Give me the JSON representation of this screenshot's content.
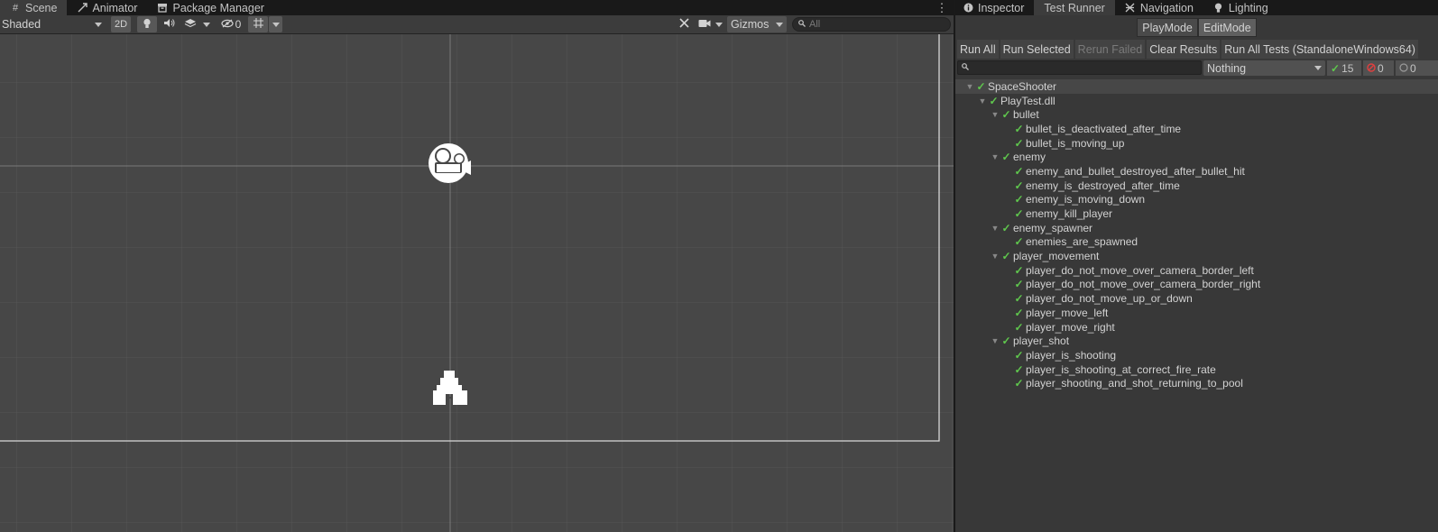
{
  "scene_tabs": [
    {
      "label": "Scene",
      "icon": "grid-icon"
    },
    {
      "label": "Animator",
      "icon": "animator-icon"
    },
    {
      "label": "Package Manager",
      "icon": "package-icon"
    }
  ],
  "scene_toolbar": {
    "shading": "Shaded",
    "mode_2d": "2D",
    "hidden_count": "0",
    "gizmos": "Gizmos",
    "search_placeholder": "All"
  },
  "right_tabs": [
    {
      "label": "Inspector",
      "icon": "info-icon"
    },
    {
      "label": "Test Runner",
      "icon": ""
    },
    {
      "label": "Navigation",
      "icon": "navigation-icon"
    },
    {
      "label": "Lighting",
      "icon": "lightbulb-icon"
    }
  ],
  "test_runner": {
    "modes": [
      "PlayMode",
      "EditMode"
    ],
    "actions": {
      "run_all": "Run All",
      "run_selected": "Run Selected",
      "rerun_failed": "Rerun Failed",
      "clear_results": "Clear Results",
      "run_all_tests": "Run All Tests (StandaloneWindows64)"
    },
    "filter": {
      "category": "Nothing"
    },
    "counts": {
      "passed": "15",
      "failed": "0",
      "skipped": "0"
    },
    "tree": [
      {
        "label": "SpaceShooter",
        "level": 0,
        "folder": true
      },
      {
        "label": "PlayTest.dll",
        "level": 1,
        "folder": true
      },
      {
        "label": "bullet",
        "level": 2,
        "folder": true
      },
      {
        "label": "bullet_is_deactivated_after_time",
        "level": 3,
        "folder": false
      },
      {
        "label": "bullet_is_moving_up",
        "level": 3,
        "folder": false
      },
      {
        "label": "enemy",
        "level": 2,
        "folder": true
      },
      {
        "label": "enemy_and_bullet_destroyed_after_bullet_hit",
        "level": 3,
        "folder": false
      },
      {
        "label": "enemy_is_destroyed_after_time",
        "level": 3,
        "folder": false
      },
      {
        "label": "enemy_is_moving_down",
        "level": 3,
        "folder": false
      },
      {
        "label": "enemy_kill_player",
        "level": 3,
        "folder": false
      },
      {
        "label": "enemy_spawner",
        "level": 2,
        "folder": true
      },
      {
        "label": "enemies_are_spawned",
        "level": 3,
        "folder": false
      },
      {
        "label": "player_movement",
        "level": 2,
        "folder": true
      },
      {
        "label": "player_do_not_move_over_camera_border_left",
        "level": 3,
        "folder": false
      },
      {
        "label": "player_do_not_move_over_camera_border_right",
        "level": 3,
        "folder": false
      },
      {
        "label": "player_do_not_move_up_or_down",
        "level": 3,
        "folder": false
      },
      {
        "label": "player_move_left",
        "level": 3,
        "folder": false
      },
      {
        "label": "player_move_right",
        "level": 3,
        "folder": false
      },
      {
        "label": "player_shot",
        "level": 2,
        "folder": true
      },
      {
        "label": "player_is_shooting",
        "level": 3,
        "folder": false
      },
      {
        "label": "player_is_shooting_at_correct_fire_rate",
        "level": 3,
        "folder": false
      },
      {
        "label": "player_shooting_and_shot_returning_to_pool",
        "level": 3,
        "folder": false
      }
    ]
  },
  "colors": {
    "pass": "#5fc74d",
    "fail": "#e04040",
    "scene_bg": "#474747",
    "panel_bg": "#383838"
  }
}
